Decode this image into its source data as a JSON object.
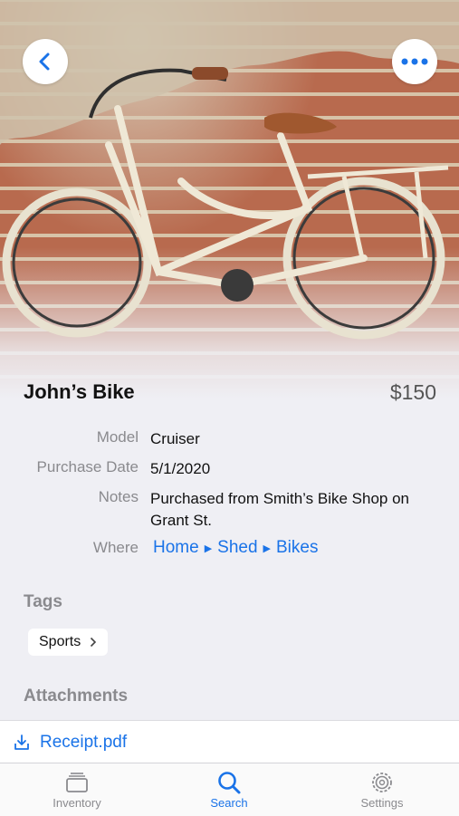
{
  "item": {
    "name": "John’s Bike",
    "price": "$150"
  },
  "details": {
    "model_label": "Model",
    "model_value": "Cruiser",
    "purchase_date_label": "Purchase Date",
    "purchase_date_value": "5/1/2020",
    "notes_label": "Notes",
    "notes_value": "Purchased from Smith’s Bike Shop on Grant St.",
    "where_label": "Where",
    "where_path": [
      "Home",
      "Shed",
      "Bikes"
    ]
  },
  "tags": {
    "heading": "Tags",
    "items": [
      "Sports"
    ]
  },
  "attachments": {
    "heading": "Attachments",
    "files": [
      "Receipt.pdf"
    ]
  },
  "tabbar": {
    "items": [
      {
        "label": "Inventory",
        "icon": "inventory-icon"
      },
      {
        "label": "Search",
        "icon": "search-icon",
        "active": true
      },
      {
        "label": "Settings",
        "icon": "settings-icon"
      }
    ]
  },
  "colors": {
    "accent": "#1a73e8",
    "background": "#efeff4"
  }
}
